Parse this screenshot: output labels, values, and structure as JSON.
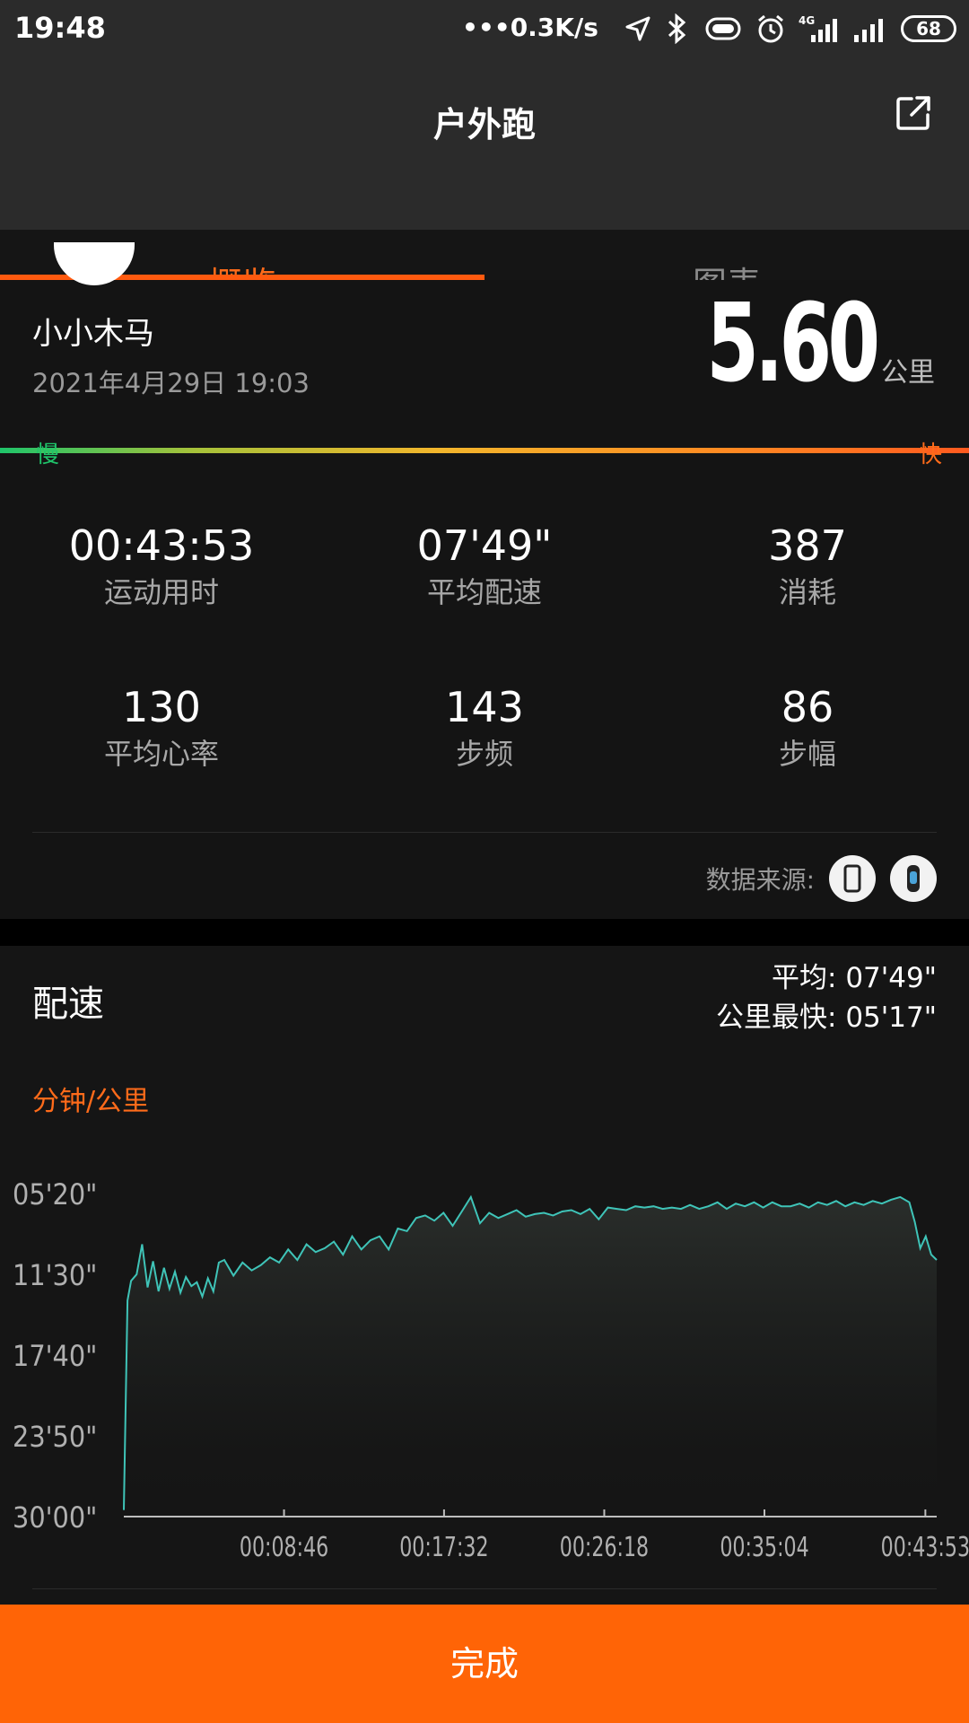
{
  "status_bar": {
    "time": "19:48",
    "net_speed": "•••0.3K/s",
    "network_type": "4G",
    "battery": "68",
    "icons": [
      "location-arrow-icon",
      "bluetooth-icon",
      "vibrate-icon",
      "alarm-icon",
      "signal-4g-icon",
      "signal-icon",
      "battery-icon"
    ]
  },
  "header": {
    "title": "户外跑",
    "share_icon": "share-external-icon"
  },
  "tabs": [
    {
      "label": "概览",
      "active": true
    },
    {
      "label": "图表",
      "active": false
    }
  ],
  "summary": {
    "user_name": "小小木马",
    "datetime": "2021年4月29日 19:03",
    "distance": "5.60",
    "distance_unit": "公里",
    "speed_bar": {
      "slow": "慢",
      "fast": "快"
    }
  },
  "stats": [
    {
      "value": "00:43:53",
      "label": "运动用时"
    },
    {
      "value": "07'49\"",
      "label": "平均配速"
    },
    {
      "value": "387",
      "label": "消耗"
    },
    {
      "value": "130",
      "label": "平均心率"
    },
    {
      "value": "143",
      "label": "步频"
    },
    {
      "value": "86",
      "label": "步幅"
    }
  ],
  "data_source": {
    "label": "数据来源:",
    "icons": [
      "phone-icon",
      "band-icon"
    ]
  },
  "pace": {
    "title": "配速",
    "avg": "平均: 07'49\"",
    "fastest_km": "公里最快: 05'17\"",
    "unit": "分钟/公里"
  },
  "chart_data": {
    "type": "area",
    "y_ticks": [
      "05'20\"",
      "11'30\"",
      "17'40\"",
      "23'50\"",
      "30'00\""
    ],
    "y_tick_minutes": [
      5.33,
      11.5,
      17.67,
      23.83,
      30.0
    ],
    "y_range_minutes": [
      5.33,
      30.0
    ],
    "y_inverted": true,
    "x_ticks": [
      "00:08:46",
      "00:17:32",
      "00:26:18",
      "00:35:04",
      "00:43:53"
    ],
    "x_tick_minutes": [
      8.77,
      17.53,
      26.3,
      35.07,
      43.88
    ],
    "x_range_minutes": [
      0,
      44.5
    ],
    "series": [
      {
        "x": [
          0.0,
          0.2,
          0.4,
          0.7,
          1.0,
          1.3,
          1.6,
          1.9,
          2.2,
          2.5,
          2.8,
          3.1,
          3.4,
          3.7,
          4.0,
          4.3,
          4.6,
          4.9,
          5.2,
          5.5,
          6.0,
          6.5,
          7.0,
          7.5,
          8.0,
          8.5,
          9.0,
          9.5,
          10.0,
          10.5,
          11.0,
          11.5,
          12.0,
          12.5,
          13.0,
          13.5,
          14.0,
          14.5,
          15.0,
          15.5,
          16.0,
          16.5,
          17.0,
          17.5,
          18.0,
          18.5,
          19.0,
          19.5,
          20.0,
          20.5,
          21.0,
          21.5,
          22.0,
          22.5,
          23.0,
          23.5,
          24.0,
          24.5,
          25.0,
          25.5,
          26.0,
          26.5,
          27.0,
          27.5,
          28.0,
          28.5,
          29.0,
          29.5,
          30.0,
          30.5,
          31.0,
          31.5,
          32.0,
          32.5,
          33.0,
          33.5,
          34.0,
          34.5,
          35.0,
          35.5,
          36.0,
          36.5,
          37.0,
          37.5,
          38.0,
          38.5,
          39.0,
          39.5,
          40.0,
          40.5,
          41.0,
          41.5,
          42.0,
          42.5,
          43.0,
          43.3,
          43.6,
          43.9,
          44.2,
          44.5
        ],
        "y": [
          29.5,
          13.5,
          12.0,
          11.5,
          9.2,
          12.5,
          10.5,
          12.8,
          11.0,
          12.6,
          11.3,
          12.9,
          11.7,
          12.4,
          12.1,
          13.2,
          11.8,
          12.8,
          10.6,
          10.4,
          11.6,
          10.6,
          11.2,
          10.8,
          10.2,
          10.6,
          9.6,
          10.4,
          9.2,
          9.8,
          9.5,
          9.0,
          10.0,
          8.6,
          9.6,
          8.9,
          8.6,
          9.6,
          8.0,
          8.2,
          7.2,
          7.0,
          7.4,
          6.8,
          7.8,
          6.7,
          5.6,
          7.6,
          6.8,
          7.2,
          6.9,
          6.6,
          7.1,
          6.9,
          6.8,
          7.0,
          6.7,
          6.6,
          6.9,
          6.5,
          7.3,
          6.4,
          6.5,
          6.6,
          6.3,
          6.4,
          6.3,
          6.5,
          6.4,
          6.5,
          6.2,
          6.5,
          6.3,
          6.0,
          6.5,
          6.1,
          6.3,
          6.0,
          6.4,
          6.0,
          6.3,
          6.3,
          6.1,
          6.4,
          6.0,
          6.2,
          5.9,
          6.3,
          6.0,
          6.2,
          5.9,
          6.1,
          5.8,
          5.6,
          6.0,
          7.5,
          9.5,
          8.6,
          10.0,
          10.4
        ]
      }
    ],
    "line_color": "#3fc4b8",
    "grid": false
  },
  "done_button": {
    "label": "完成"
  }
}
